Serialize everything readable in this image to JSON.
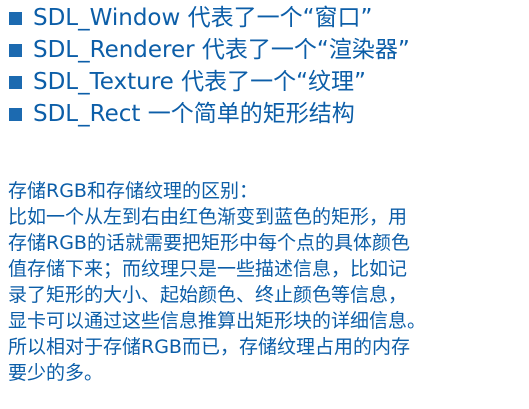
{
  "bullets": [
    {
      "text": "SDL_Window 代表了一个“窗口”"
    },
    {
      "text": "SDL_Renderer 代表了一个“渲染器”"
    },
    {
      "text": "SDL_Texture 代表了一个“纹理”"
    },
    {
      "text": "SDL_Rect 一个简单的矩形结构"
    }
  ],
  "note": {
    "lines": [
      "存储RGB和存储纹理的区别：",
      "比如一个从左到右由红色渐变到蓝色的矩形，用",
      "存储RGB的话就需要把矩形中每个点的具体颜色",
      "值存储下来；而纹理只是一些描述信息，比如记",
      "录了矩形的大小、起始颜色、终止颜色等信息，",
      "显卡可以通过这些信息推算出矩形块的详细信息。",
      "所以相对于存储RGB而已，存储纹理占用的内存",
      "要少的多。"
    ]
  },
  "colors": {
    "text": "#0c5ea8",
    "bullet": "#1c6ab0"
  }
}
